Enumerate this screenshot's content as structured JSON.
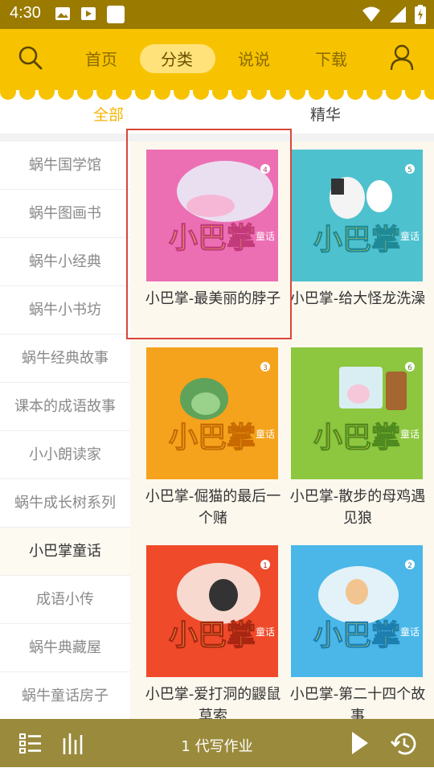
{
  "status_bar": {
    "time": "4:30"
  },
  "nav": {
    "items": [
      {
        "label": "首页"
      },
      {
        "label": "分类"
      },
      {
        "label": "说说"
      },
      {
        "label": "下载"
      }
    ],
    "active": "分类"
  },
  "sub_tabs": [
    {
      "label": "全部"
    },
    {
      "label": "精华"
    }
  ],
  "sidebar": {
    "items": [
      {
        "label": "蜗牛国学馆"
      },
      {
        "label": "蜗牛图画书"
      },
      {
        "label": "蜗牛小经典"
      },
      {
        "label": "蜗牛小书坊"
      },
      {
        "label": "蜗牛经典故事"
      },
      {
        "label": "课本的成语故事"
      },
      {
        "label": "小小朗读家"
      },
      {
        "label": "蜗牛成长树系列"
      },
      {
        "label": "小巴掌童话"
      },
      {
        "label": "成语小传"
      },
      {
        "label": "蜗牛典藏屋"
      },
      {
        "label": "蜗牛童话房子"
      }
    ],
    "active": "小巴掌童话"
  },
  "books": [
    {
      "title": "小巴掌-最美丽的脖子",
      "cover_series": "小巴掌",
      "cover_tag": "童话",
      "cover_color": "#ec6fb4",
      "cover_number": "4"
    },
    {
      "title": "小巴掌-给大怪龙洗澡",
      "cover_series": "小巴掌",
      "cover_tag": "童话",
      "cover_color": "#4ec1cf",
      "cover_number": "5"
    },
    {
      "title": "小巴掌-倔猫的最后一个赌",
      "cover_series": "小巴掌",
      "cover_tag": "童话",
      "cover_color": "#f5a21c",
      "cover_number": "3"
    },
    {
      "title": "小巴掌-散步的母鸡遇见狼",
      "cover_series": "小巴掌",
      "cover_tag": "童话",
      "cover_color": "#8dc63f",
      "cover_number": "6"
    },
    {
      "title": "小巴掌-爱打洞的鼹鼠草索",
      "cover_series": "小巴掌",
      "cover_tag": "童话",
      "cover_color": "#ef4a2a",
      "cover_number": "1"
    },
    {
      "title": "小巴掌-第二十四个故事",
      "cover_series": "小巴掌",
      "cover_tag": "童话",
      "cover_color": "#4ab7e8",
      "cover_number": "2"
    }
  ],
  "player": {
    "now_playing": "1 代写作业"
  },
  "colors": {
    "nav_bg": "#f7c300",
    "status_bg": "#9a7b00",
    "player_bg": "#9a8a3c",
    "active_tab": "#f5b400",
    "highlight": "#d9463a"
  }
}
